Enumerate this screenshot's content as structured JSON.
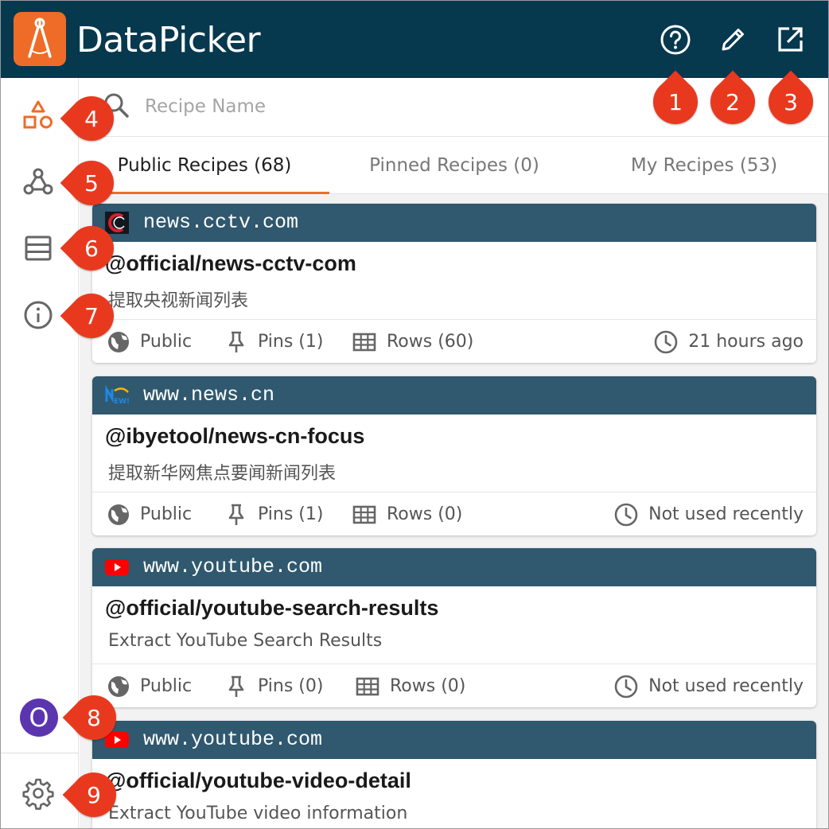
{
  "header": {
    "app_title": "DataPicker",
    "buttons": [
      {
        "icon": "help-circle-icon",
        "label": "Help"
      },
      {
        "icon": "pencil-icon",
        "label": "Edit"
      },
      {
        "icon": "open-external-icon",
        "label": "Open in new window"
      }
    ]
  },
  "sidebar": {
    "items": [
      {
        "icon": "shapes-icon",
        "active": true
      },
      {
        "icon": "webhook-icon",
        "active": false
      },
      {
        "icon": "table-rows-icon",
        "active": false
      },
      {
        "icon": "info-icon",
        "active": false
      }
    ],
    "avatar_letter": "O",
    "settings_icon": "gear-icon"
  },
  "search": {
    "placeholder": "Recipe Name",
    "value": ""
  },
  "tabs": [
    {
      "label": "Public Recipes (68)",
      "active": true
    },
    {
      "label": "Pinned Recipes (0)",
      "active": false
    },
    {
      "label": "My Recipes (53)",
      "active": false
    }
  ],
  "recipes": [
    {
      "site": "news.cctv.com",
      "site_icon": "cctv-logo-icon",
      "name": "@official/news-cctv-com",
      "description": "提取央视新闻列表",
      "visibility": "Public",
      "pins": "Pins (1)",
      "rows": "Rows (60)",
      "last_used": "21 hours ago"
    },
    {
      "site": "www.news.cn",
      "site_icon": "xinhua-news-logo-icon",
      "name": "@ibyetool/news-cn-focus",
      "description": "提取新华网焦点要闻新闻列表",
      "visibility": "Public",
      "pins": "Pins (1)",
      "rows": "Rows (0)",
      "last_used": "Not used recently"
    },
    {
      "site": "www.youtube.com",
      "site_icon": "youtube-logo-icon",
      "name": "@official/youtube-search-results",
      "description": "Extract YouTube Search Results",
      "visibility": "Public",
      "pins": "Pins (0)",
      "rows": "Rows (0)",
      "last_used": "Not used recently"
    },
    {
      "site": "www.youtube.com",
      "site_icon": "youtube-logo-icon",
      "name": "@official/youtube-video-detail",
      "description": "Extract YouTube video information"
    }
  ],
  "markers": [
    "1",
    "2",
    "3",
    "4",
    "5",
    "6",
    "7",
    "8",
    "9"
  ],
  "colors": {
    "header_bg": "#06384e",
    "card_header_bg": "#30586e",
    "accent_orange": "#ee6c28",
    "marker_red": "#e8391f",
    "avatar_purple": "#5b35b0"
  }
}
